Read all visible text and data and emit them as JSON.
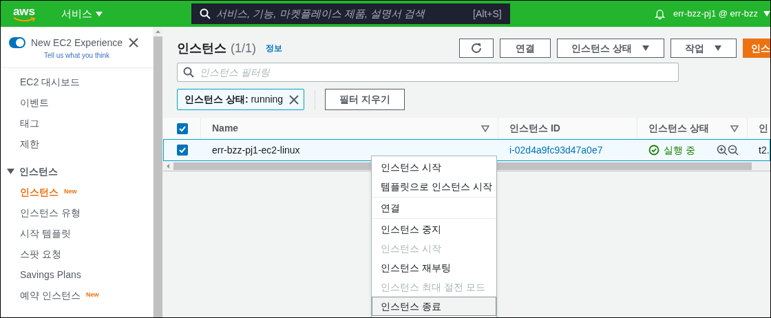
{
  "top_bar": {
    "logo": "aws",
    "services": "서비스",
    "search_placeholder": "서비스, 기능, 마켓플레이스 제품, 설명서 검색",
    "shortcut": "[Alt+S]",
    "account": "err-bzz-pj1 @ err-bzz"
  },
  "sidebar": {
    "experience": {
      "label": "New EC2 Experience",
      "on": true,
      "link": "Tell us what you think"
    },
    "items": [
      {
        "label": "EC2 대시보드"
      },
      {
        "label": "이벤트"
      },
      {
        "label": "태그"
      },
      {
        "label": "제한"
      }
    ],
    "sections": [
      {
        "title": "인스턴스",
        "expanded": true,
        "items": [
          {
            "label": "인스턴스",
            "badge": "New",
            "selected": true
          },
          {
            "label": "인스턴스 유형",
            "selected": false
          },
          {
            "label": "시작 템플릿",
            "selected": false
          },
          {
            "label": "스팟 요청",
            "selected": false
          },
          {
            "label": "Savings Plans",
            "selected": false
          },
          {
            "label": "예약 인스턴스",
            "badge": "New",
            "selected": false
          }
        ]
      }
    ]
  },
  "main": {
    "title": "인스턴스",
    "count": "(1/1)",
    "info": "정보",
    "buttons": [
      {
        "kind": "refresh"
      },
      {
        "kind": "plain",
        "label": "연결"
      },
      {
        "kind": "dropdown",
        "label": "인스턴스 상태"
      },
      {
        "kind": "dropdown",
        "label": "작업"
      },
      {
        "kind": "primary",
        "label": "인스"
      }
    ],
    "filter_placeholder": "인스턴스 필터링",
    "filter_chip": {
      "key": "인스턴스 상태:",
      "value": "running"
    },
    "clear_filters": "필터 지우기",
    "table": {
      "all_checked": true,
      "columns": [
        {
          "label": "Name",
          "filter": true
        },
        {
          "label": "인스턴스 ID",
          "filter": false
        },
        {
          "label": "인스턴스 상태",
          "filter": true
        },
        {
          "label": "인",
          "filter": false
        }
      ],
      "rows": [
        {
          "selected": true,
          "name": "err-bzz-pj1-ec2-linux",
          "id": "i-02d4a9fc93d47a0e7",
          "state": "실행 중",
          "type": "t2."
        }
      ]
    }
  },
  "context_menu": {
    "groups": [
      [
        {
          "label": "인스턴스 시작",
          "disabled": false,
          "highlighted": false
        },
        {
          "label": "템플릿으로 인스턴스 시작",
          "disabled": false,
          "highlighted": false
        }
      ],
      [
        {
          "label": "연결",
          "disabled": false,
          "highlighted": false
        }
      ],
      [
        {
          "label": "인스턴스 중지",
          "disabled": false,
          "highlighted": false
        },
        {
          "label": "인스턴스 시작",
          "disabled": true,
          "highlighted": false
        },
        {
          "label": "인스턴스 재부팅",
          "disabled": false,
          "highlighted": false
        },
        {
          "label": "인스턴스 최대 절전 모드",
          "disabled": true,
          "highlighted": false
        },
        {
          "label": "인스턴스 종료",
          "disabled": false,
          "highlighted": true
        }
      ]
    ]
  }
}
